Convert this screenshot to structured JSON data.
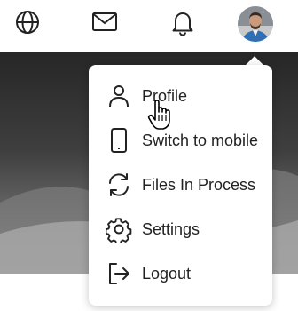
{
  "topbar": {
    "icons": [
      {
        "name": "globe-icon"
      },
      {
        "name": "mail-icon"
      },
      {
        "name": "bell-icon"
      }
    ],
    "avatar": {
      "name": "avatar"
    }
  },
  "menu": {
    "items": [
      {
        "label": "Profile",
        "icon": "user-icon"
      },
      {
        "label": "Switch to mobile",
        "icon": "mobile-icon"
      },
      {
        "label": "Files In Process",
        "icon": "sync-icon"
      },
      {
        "label": "Settings",
        "icon": "gear-icon"
      },
      {
        "label": "Logout",
        "icon": "logout-icon"
      }
    ]
  },
  "colors": {
    "icon_stroke": "#222222",
    "menu_bg": "#ffffff"
  }
}
